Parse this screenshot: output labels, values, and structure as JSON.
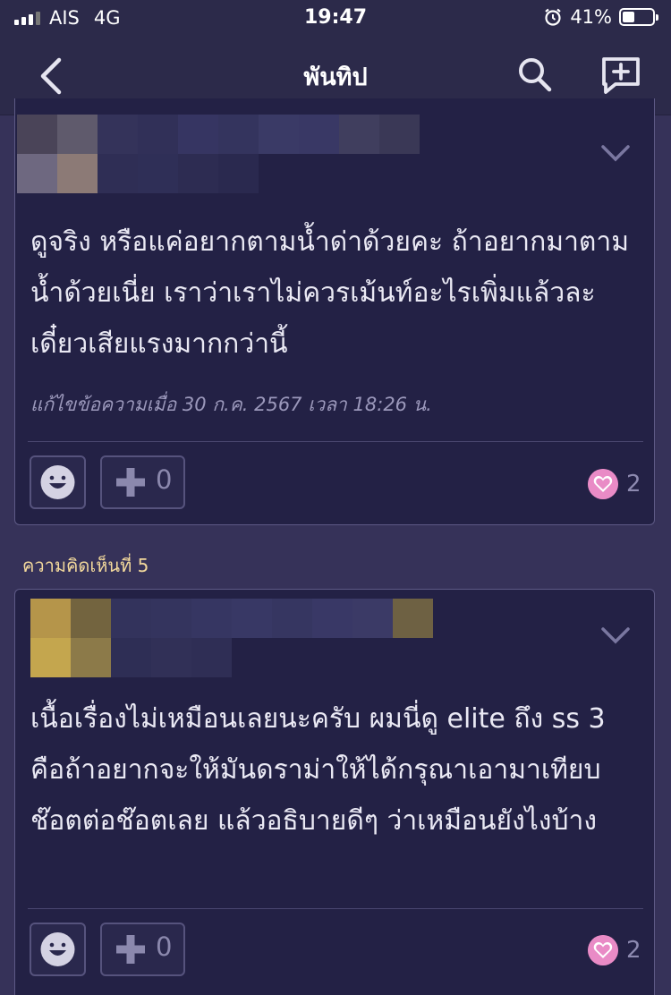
{
  "status_bar": {
    "carrier": "AIS",
    "network": "4G",
    "time": "19:47",
    "battery": "41%",
    "battery_level": 0.41,
    "icons": [
      "signal-icon",
      "alarm-icon",
      "battery-icon"
    ]
  },
  "nav": {
    "title": "พันทิป",
    "icons": [
      "back-icon",
      "search-icon",
      "new-topic-icon"
    ]
  },
  "comments": [
    {
      "label": "",
      "body": "ดูจริง หรือแค่อยากตามน้ำด่าด้วยคะ ถ้าอยากมาตามน้ำด้วยเนี่ย เราว่าเราไม่ควรเม้นท์อะไรเพิ่มแล้วละ เดี๋ยวเสียแรงมากกว่านี้",
      "edit_note": "แก้ไขข้อความเมื่อ 30 ก.ค. 2567 เวลา 18:26 น.",
      "plus_count": "0",
      "heart_count": "2"
    },
    {
      "label": "ความคิดเห็นที่ 5",
      "body": "เนื้อเรื่องไม่เหมือนเลยนะครับ ผมนี่ดู elite ถึง ss 3 คือถ้าอยากจะให้มันดราม่าให้ได้กรุณาเอามาเทียบช๊อตต่อช๊อตเลย แล้วอธิบายดีๆ ว่าเหมือนยังไงบ้าง",
      "plus_count": "0",
      "heart_count": "2"
    }
  ],
  "colors": {
    "background": "#363259",
    "card": "#232145",
    "bar": "#2c2a4a",
    "heart": "#e98bc6",
    "label": "#f3d99c"
  }
}
